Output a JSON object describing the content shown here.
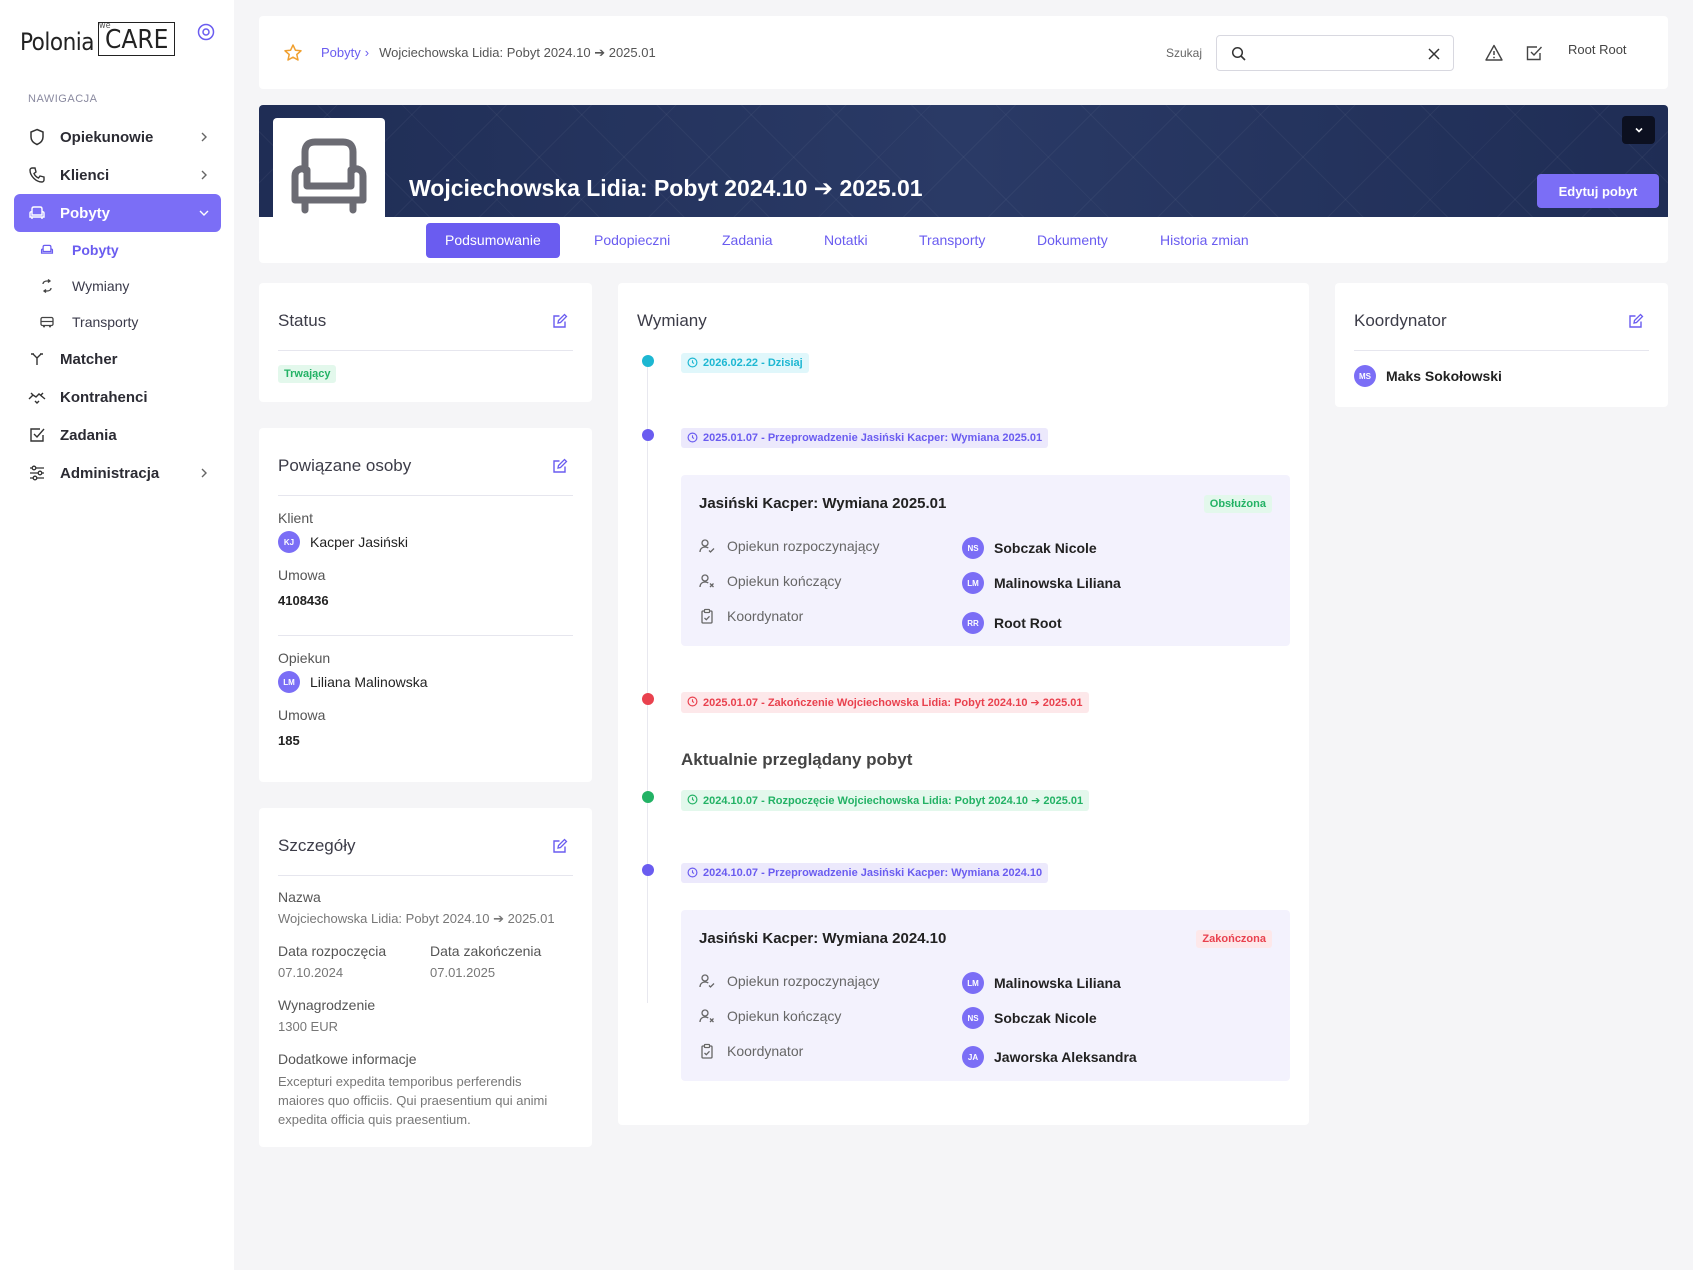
{
  "sidebar": {
    "logo_text": "Polonia",
    "logo_box": "CARE",
    "logo_we": "we",
    "section": "NAWIGACJA",
    "items": [
      {
        "label": "Opiekunowie"
      },
      {
        "label": "Klienci"
      },
      {
        "label": "Pobyty"
      },
      {
        "label": "Matcher"
      },
      {
        "label": "Kontrahenci"
      },
      {
        "label": "Zadania"
      },
      {
        "label": "Administracja"
      }
    ],
    "sub_items": [
      {
        "label": "Pobyty"
      },
      {
        "label": "Wymiany"
      },
      {
        "label": "Transporty"
      }
    ]
  },
  "topbar": {
    "breadcrumb_link": "Pobyty",
    "breadcrumb_sep": "›",
    "breadcrumb_current": "Wojciechowska Lidia: Pobyt 2024.10 ➔ 2025.01",
    "search_label": "Szukaj",
    "search_value": "",
    "user": "Root Root"
  },
  "banner": {
    "title": "Wojciechowska Lidia: Pobyt 2024.10 ➔ 2025.01",
    "edit_label": "Edytuj pobyt"
  },
  "tabs": [
    {
      "label": "Podsumowanie"
    },
    {
      "label": "Podopieczni"
    },
    {
      "label": "Zadania"
    },
    {
      "label": "Notatki"
    },
    {
      "label": "Transporty"
    },
    {
      "label": "Dokumenty"
    },
    {
      "label": "Historia zmian"
    }
  ],
  "status": {
    "title": "Status",
    "value": "Trwający"
  },
  "related": {
    "title": "Powiązane osoby",
    "client_label": "Klient",
    "client_initials": "KJ",
    "client_name": "Kacper Jasiński",
    "client_contract_label": "Umowa",
    "client_contract": "4108436",
    "carer_label": "Opiekun",
    "carer_initials": "LM",
    "carer_name": "Liliana Malinowska",
    "carer_contract_label": "Umowa",
    "carer_contract": "185"
  },
  "details": {
    "title": "Szczegóły",
    "name_label": "Nazwa",
    "name": "Wojciechowska Lidia: Pobyt 2024.10 ➔ 2025.01",
    "start_label": "Data rozpoczęcia",
    "start": "07.10.2024",
    "end_label": "Data zakończenia",
    "end": "07.01.2025",
    "salary_label": "Wynagrodzenie",
    "salary": "1300 EUR",
    "extra_label": "Dodatkowe informacje",
    "extra": "Excepturi expedita temporibus perferendis maiores quo officiis. Qui praesentium qui animi expedita officia quis praesentium."
  },
  "exchanges": {
    "title": "Wymiany",
    "current_label": "Aktualnie przeglądany pobyt",
    "tags": {
      "today": "2026.02.22 - Dzisiaj",
      "ex1": "2025.01.07 - Przeprowadzenie Jasiński Kacper: Wymiana 2025.01",
      "end": "2025.01.07 - Zakończenie Wojciechowska Lidia: Pobyt 2024.10 ➔ 2025.01",
      "start": "2024.10.07 - Rozpoczęcie Wojciechowska Lidia: Pobyt 2024.10 ➔ 2025.01",
      "ex2": "2024.10.07 - Przeprowadzenie Jasiński Kacper: Wymiana 2024.10"
    },
    "cards": [
      {
        "title": "Jasiński Kacper: Wymiana 2025.01",
        "status": "Obsłużona",
        "start_label": "Opiekun rozpoczynający",
        "start_initials": "NS",
        "start_name": "Sobczak Nicole",
        "end_label": "Opiekun kończący",
        "end_initials": "LM",
        "end_name": "Malinowska Liliana",
        "coord_label": "Koordynator",
        "coord_initials": "RR",
        "coord_name": "Root Root"
      },
      {
        "title": "Jasiński Kacper: Wymiana 2024.10",
        "status": "Zakończona",
        "start_label": "Opiekun rozpoczynający",
        "start_initials": "LM",
        "start_name": "Malinowska Liliana",
        "end_label": "Opiekun kończący",
        "end_initials": "NS",
        "end_name": "Sobczak Nicole",
        "coord_label": "Koordynator",
        "coord_initials": "JA",
        "coord_name": "Jaworska Aleksandra"
      }
    ]
  },
  "coordinator": {
    "title": "Koordynator",
    "initials": "MS",
    "name": "Maks Sokołowski"
  },
  "colors": {
    "accent": "#7b6ef6",
    "banner": "#1f2d55",
    "green": "#23b265",
    "red": "#e9414e",
    "cyan": "#1db7d2"
  }
}
